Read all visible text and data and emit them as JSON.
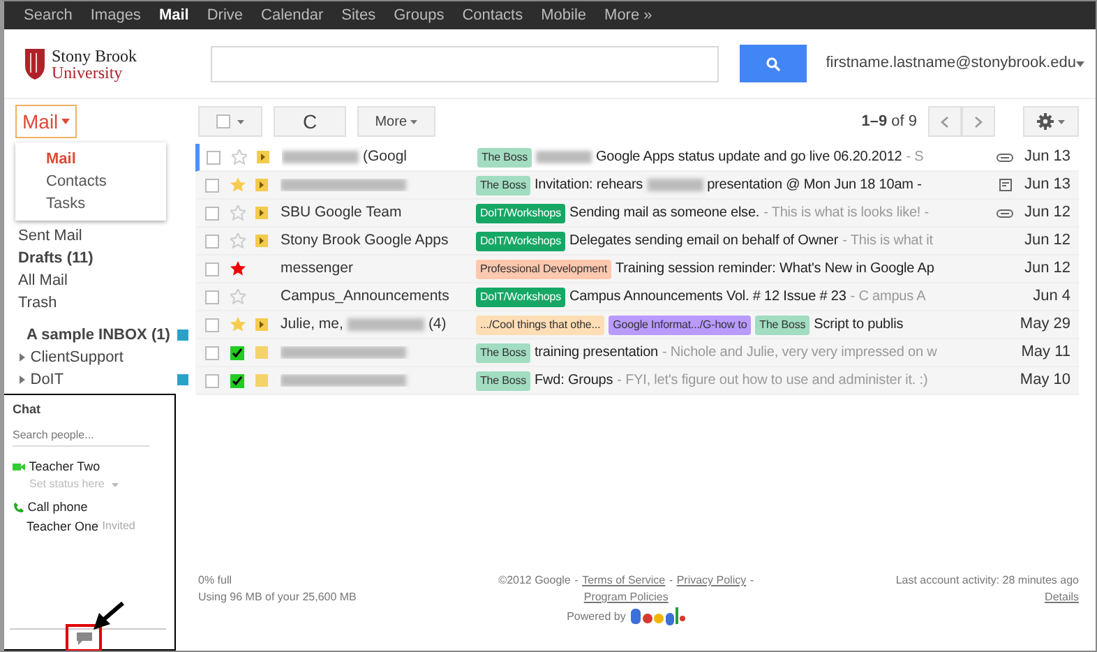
{
  "top_nav": [
    {
      "label": "Search",
      "selected": false
    },
    {
      "label": "Images",
      "selected": false
    },
    {
      "label": "Mail",
      "selected": true
    },
    {
      "label": "Drive",
      "selected": false
    },
    {
      "label": "Calendar",
      "selected": false
    },
    {
      "label": "Sites",
      "selected": false
    },
    {
      "label": "Groups",
      "selected": false
    },
    {
      "label": "Contacts",
      "selected": false
    },
    {
      "label": "Mobile",
      "selected": false
    },
    {
      "label": "More »",
      "selected": false
    }
  ],
  "header": {
    "logo_line1": "Stony Brook",
    "logo_line2": "University",
    "account": "firstname.lastname@stonybrook.edu"
  },
  "app_switcher": {
    "label": "Mail",
    "menu": [
      {
        "label": "Mail",
        "selected": true
      },
      {
        "label": "Contacts",
        "selected": false
      },
      {
        "label": "Tasks",
        "selected": false
      }
    ]
  },
  "folders": [
    {
      "label": "Sent Mail",
      "bold": false,
      "expandable": false
    },
    {
      "label": "Drafts (11)",
      "bold": true,
      "expandable": false
    },
    {
      "label": "All Mail",
      "bold": false,
      "expandable": false
    },
    {
      "label": "Trash",
      "bold": false,
      "expandable": false
    },
    {
      "label": "A sample INBOX (1)",
      "bold": true,
      "expandable": false,
      "color": "#2aa2c8"
    },
    {
      "label": "ClientSupport",
      "bold": false,
      "expandable": true
    },
    {
      "label": "DoIT",
      "bold": false,
      "expandable": true,
      "color": "#2aa2c8"
    }
  ],
  "toolbar": {
    "select_all": {
      "checked": false
    },
    "refresh": "C",
    "more": "More",
    "page_info": "**1–9** of 9"
  },
  "messages": [
    {
      "focused": true,
      "checked": false,
      "star": {
        "kind": "outline"
      },
      "marker": {
        "kind": "important"
      },
      "sender": [
        {
          "kind": "redacted"
        },
        {
          "kind": "text",
          "text": "(Googl"
        }
      ],
      "labels": [
        {
          "text": "The Boss",
          "color": "#a2dcc1"
        }
      ],
      "subject": [
        {
          "kind": "redacted"
        },
        {
          "kind": "subject",
          "text": "Google Apps status update and go live 06.20.2012"
        },
        {
          "kind": "snippet",
          "text": "- S"
        }
      ],
      "attachment": {
        "kind": "clip"
      },
      "date": "Jun 13"
    },
    {
      "focused": false,
      "checked": false,
      "star": {
        "kind": "yellow"
      },
      "marker": {
        "kind": "important"
      },
      "sender": [
        {
          "kind": "redacted"
        }
      ],
      "labels": [
        {
          "text": "The Boss",
          "color": "#a2dcc1"
        }
      ],
      "subject": [
        {
          "kind": "subject",
          "text": "Invitation: rehears"
        },
        {
          "kind": "redacted"
        },
        {
          "kind": "subject",
          "text": "presentation @ Mon Jun 18 10am -"
        }
      ],
      "attachment": {
        "kind": "calendar"
      },
      "date": "Jun 13"
    },
    {
      "focused": false,
      "checked": false,
      "star": {
        "kind": "outline"
      },
      "marker": {
        "kind": "important"
      },
      "sender": [
        {
          "kind": "text",
          "text": "SBU Google Team"
        }
      ],
      "labels": [
        {
          "text": "DoIT/Workshops",
          "color": "#16a765"
        }
      ],
      "subject": [
        {
          "kind": "subject",
          "text": "Sending mail as someone else."
        },
        {
          "kind": "snippet",
          "text": "- This is what is looks like! -"
        }
      ],
      "attachment": {
        "kind": "clip"
      },
      "date": "Jun 12"
    },
    {
      "focused": false,
      "checked": false,
      "star": {
        "kind": "outline"
      },
      "marker": {
        "kind": "important"
      },
      "sender": [
        {
          "kind": "text",
          "text": "Stony Brook Google Apps"
        }
      ],
      "labels": [
        {
          "text": "DoIT/Workshops",
          "color": "#16a765"
        }
      ],
      "subject": [
        {
          "kind": "subject",
          "text": "Delegates sending email on behalf of Owner"
        },
        {
          "kind": "snippet",
          "text": "- This is what it"
        }
      ],
      "date": "Jun 12"
    },
    {
      "focused": false,
      "checked": false,
      "star": {
        "kind": "red"
      },
      "sender": [
        {
          "kind": "text",
          "text": "messenger"
        }
      ],
      "labels": [
        {
          "text": "Professional Development",
          "color": "#ffc8af"
        }
      ],
      "subject": [
        {
          "kind": "subject",
          "text": "Training session reminder: What's New in Google Ap"
        }
      ],
      "date": "Jun 12"
    },
    {
      "focused": false,
      "checked": false,
      "star": {
        "kind": "outline"
      },
      "sender": [
        {
          "kind": "text",
          "text": "Campus_Announcements"
        }
      ],
      "labels": [
        {
          "text": "DoIT/Workshops",
          "color": "#16a765"
        }
      ],
      "subject": [
        {
          "kind": "subject",
          "text": "Campus Announcements Vol. # 12 Issue # 23"
        },
        {
          "kind": "snippet",
          "text": "- C ampus A"
        }
      ],
      "date": "Jun 4"
    },
    {
      "focused": false,
      "checked": false,
      "star": {
        "kind": "yellow"
      },
      "marker": {
        "kind": "important"
      },
      "sender": [
        {
          "kind": "text",
          "text": "Julie, me,"
        },
        {
          "kind": "redacted"
        },
        {
          "kind": "text",
          "text": "(4)"
        }
      ],
      "labels": [
        {
          "text": ".../Cool things that othe...",
          "color": "#ffdeb5"
        },
        {
          "text": "Google Informat.../G-how to",
          "color": "#b99aff"
        },
        {
          "text": "The Boss",
          "color": "#a2dcc1"
        }
      ],
      "subject": [
        {
          "kind": "subject",
          "text": "Script to publis"
        }
      ],
      "date": "May 29"
    },
    {
      "focused": false,
      "checked": false,
      "star": {
        "kind": "check"
      },
      "marker": {
        "kind": "plain"
      },
      "sender": [
        {
          "kind": "redacted"
        }
      ],
      "labels": [
        {
          "text": "The Boss",
          "color": "#a2dcc1"
        }
      ],
      "subject": [
        {
          "kind": "subject",
          "text": "training presentation"
        },
        {
          "kind": "snippet",
          "text": "- Nichole and Julie, very very impressed on w"
        }
      ],
      "date": "May 11"
    },
    {
      "focused": false,
      "checked": false,
      "star": {
        "kind": "check"
      },
      "marker": {
        "kind": "plain"
      },
      "sender": [
        {
          "kind": "redacted"
        }
      ],
      "labels": [
        {
          "text": "The Boss",
          "color": "#a2dcc1"
        }
      ],
      "subject": [
        {
          "kind": "subject",
          "text": "Fwd: Groups"
        },
        {
          "kind": "snippet",
          "text": "- FYI, let's figure out how to use and administer it. :)"
        }
      ],
      "date": "May 10"
    }
  ],
  "chat": {
    "title": "Chat",
    "search": {
      "placeholder": "Search people..."
    },
    "contacts": [
      {
        "kind": "video",
        "name": "Teacher Two",
        "status": "Set status here"
      },
      {
        "kind": "phone",
        "name": "Call phone"
      },
      {
        "kind": "plain",
        "name": "Teacher One",
        "status": "Invited"
      }
    ]
  },
  "footer": {
    "usage": "0% full",
    "usage_detail": "Using 96 MB of your 25,600 MB",
    "copyright": "©2012 Google",
    "links": [
      {
        "text": "Terms of Service",
        "separator": "-"
      },
      {
        "text": "Privacy Policy",
        "separator": "-"
      },
      {
        "text": "Program Policies"
      }
    ],
    "copyright_separator": "-",
    "powered_by": "Powered by",
    "activity": "Last account activity: 28 minutes ago",
    "details": "Details"
  }
}
